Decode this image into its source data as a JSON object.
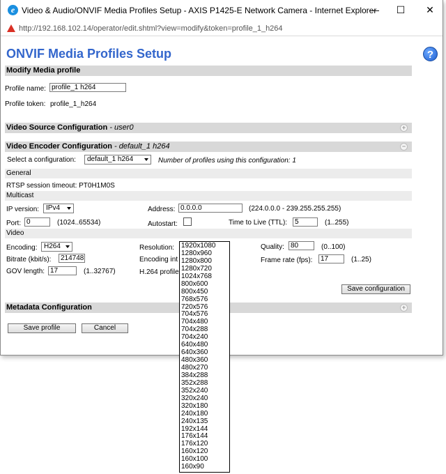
{
  "window": {
    "title": "Video & Audio/ONVIF Media Profiles Setup - AXIS P1425-E Network Camera - Internet Explorer",
    "url": "http://192.168.102.14/operator/edit.shtml?view=modify&token=profile_1_h264",
    "minimize": "—",
    "maximize": "☐",
    "close": "✕"
  },
  "page": {
    "title": "ONVIF Media Profiles Setup",
    "help": "?"
  },
  "modify": {
    "header": "Modify Media profile",
    "profile_name_label": "Profile name:",
    "profile_name_value": "profile_1 h264",
    "profile_token_label": "Profile token:",
    "profile_token_value": "profile_1_h264"
  },
  "video_source": {
    "header": "Video Source Configuration",
    "config_name": "- user0",
    "toggle": "+"
  },
  "video_encoder": {
    "header": "Video Encoder Configuration",
    "config_name": "- default_1 h264",
    "toggle": "−",
    "select_config_label": "Select a configuration:",
    "select_config_value": "default_1 h264",
    "profiles_using": "Number of profiles using this configuration: 1",
    "general_header": "General",
    "rtsp_timeout": "RTSP session timeout: PT0H1M0S",
    "multicast_header": "Multicast",
    "ip_version_label": "IP version:",
    "ip_version_value": "IPv4",
    "address_label": "Address:",
    "address_value": "0.0.0.0",
    "address_range": "(224.0.0.0 - 239.255.255.255)",
    "port_label": "Port:",
    "port_value": "0",
    "port_range": "(1024..65534)",
    "autostart_label": "Autostart:",
    "ttl_label": "Time to Live (TTL):",
    "ttl_value": "5",
    "ttl_range": "(1..255)",
    "video_header": "Video",
    "encoding_label": "Encoding:",
    "encoding_value": "H264",
    "resolution_label": "Resolution:",
    "quality_label": "Quality:",
    "quality_value": "80",
    "quality_range": "(0..100)",
    "bitrate_label": "Bitrate (kbit/s):",
    "bitrate_value": "214748",
    "encoding_interval_label": "Encoding int",
    "frame_rate_label": "Frame rate (fps):",
    "frame_rate_value": "17",
    "frame_rate_range": "(1..25)",
    "gov_length_label": "GOV length:",
    "gov_length_value": "17",
    "gov_length_range": "(1..32767)",
    "h264_profile_label": "H.264 profile",
    "save_configuration": "Save configuration"
  },
  "metadata": {
    "header": "Metadata Configuration",
    "toggle": "+"
  },
  "footer": {
    "save_profile": "Save profile",
    "cancel": "Cancel"
  },
  "resolution_options": [
    "1920x1080",
    "1280x960",
    "1280x800",
    "1280x720",
    "1024x768",
    "800x600",
    "800x450",
    "768x576",
    "720x576",
    "704x576",
    "704x480",
    "704x288",
    "704x240",
    "640x480",
    "640x360",
    "480x360",
    "480x270",
    "384x288",
    "352x288",
    "352x240",
    "320x240",
    "320x180",
    "240x180",
    "240x135",
    "192x144",
    "176x144",
    "176x120",
    "160x120",
    "160x100",
    "160x90"
  ]
}
